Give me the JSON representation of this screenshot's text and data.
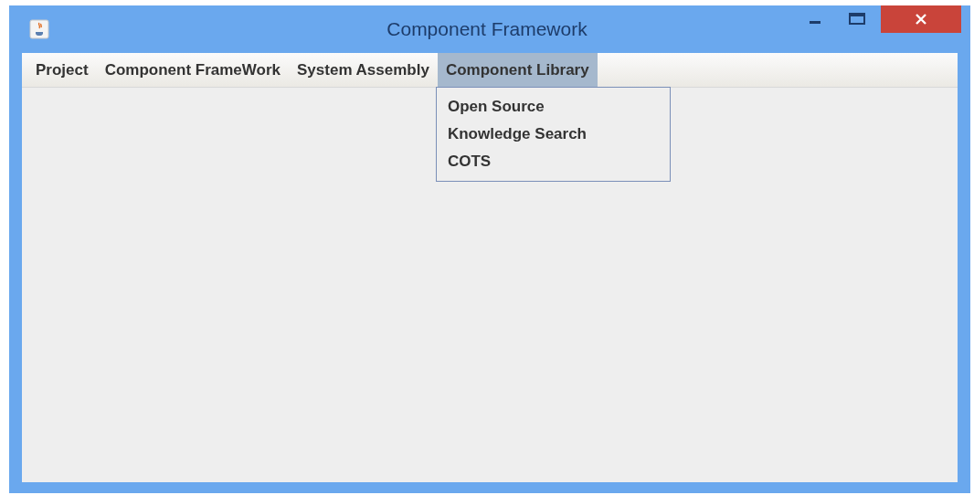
{
  "window": {
    "title": "Component Framework"
  },
  "menu_bar": [
    {
      "label": "Project",
      "selected": false
    },
    {
      "label": "Component FrameWork",
      "selected": false
    },
    {
      "label": "System Assembly",
      "selected": false
    },
    {
      "label": "Component Library",
      "selected": true,
      "items": [
        "Open Source",
        "Knowledge Search",
        "COTS"
      ]
    }
  ]
}
